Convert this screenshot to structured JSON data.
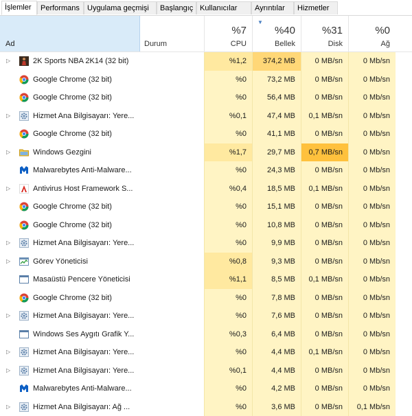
{
  "tabs": [
    {
      "label": "İşlemler",
      "active": true
    },
    {
      "label": "Performans",
      "active": false
    },
    {
      "label": "Uygulama geçmişi",
      "active": false
    },
    {
      "label": "Başlangıç",
      "active": false
    },
    {
      "label": "Kullanıcılar",
      "active": false
    },
    {
      "label": "Ayrıntılar",
      "active": false
    },
    {
      "label": "Hizmetler",
      "active": false
    }
  ],
  "header": {
    "name_label": "Ad",
    "status_label": "Durum",
    "cpu": {
      "percent": "%7",
      "label": "CPU"
    },
    "memory": {
      "percent": "%40",
      "label": "Bellek"
    },
    "disk": {
      "percent": "%31",
      "label": "Disk"
    },
    "network": {
      "percent": "%0",
      "label": "Ağ"
    }
  },
  "colors": {
    "accent": "#d9ebf9",
    "heat_light": "#fff4c4",
    "heat_medium": "#ffe9a0",
    "heat_strong": "#ffd777",
    "heat_max": "#ffc13d"
  },
  "processes": [
    {
      "name": "2K Sports NBA 2K14 (32 bit)",
      "icon": "nba-game-icon",
      "expandable": true,
      "cpu": "%1,2",
      "memory": "374,2 MB",
      "disk": "0 MB/sn",
      "network": "0 Mb/sn",
      "cpu_heat": "m",
      "mem_heat": "s",
      "disk_heat": "l",
      "net_heat": "l"
    },
    {
      "name": "Google Chrome (32 bit)",
      "icon": "chrome-icon",
      "expandable": false,
      "cpu": "%0",
      "memory": "73,2 MB",
      "disk": "0 MB/sn",
      "network": "0 Mb/sn",
      "cpu_heat": "l",
      "mem_heat": "l",
      "disk_heat": "l",
      "net_heat": "l"
    },
    {
      "name": "Google Chrome (32 bit)",
      "icon": "chrome-icon",
      "expandable": false,
      "cpu": "%0",
      "memory": "56,4 MB",
      "disk": "0 MB/sn",
      "network": "0 Mb/sn",
      "cpu_heat": "l",
      "mem_heat": "l",
      "disk_heat": "l",
      "net_heat": "l"
    },
    {
      "name": "Hizmet Ana Bilgisayarı: Yere...",
      "icon": "gear-service-icon",
      "expandable": true,
      "cpu": "%0,1",
      "memory": "47,4 MB",
      "disk": "0,1 MB/sn",
      "network": "0 Mb/sn",
      "cpu_heat": "l",
      "mem_heat": "l",
      "disk_heat": "l",
      "net_heat": "l"
    },
    {
      "name": "Google Chrome (32 bit)",
      "icon": "chrome-icon",
      "expandable": false,
      "cpu": "%0",
      "memory": "41,1 MB",
      "disk": "0 MB/sn",
      "network": "0 Mb/sn",
      "cpu_heat": "l",
      "mem_heat": "l",
      "disk_heat": "l",
      "net_heat": "l"
    },
    {
      "name": "Windows Gezgini",
      "icon": "folder-icon",
      "expandable": true,
      "cpu": "%1,7",
      "memory": "29,7 MB",
      "disk": "0,7 MB/sn",
      "network": "0 Mb/sn",
      "cpu_heat": "m",
      "mem_heat": "l",
      "disk_heat": "o",
      "net_heat": "l"
    },
    {
      "name": "Malwarebytes Anti-Malware...",
      "icon": "malwarebytes-icon",
      "expandable": false,
      "cpu": "%0",
      "memory": "24,3 MB",
      "disk": "0 MB/sn",
      "network": "0 Mb/sn",
      "cpu_heat": "l",
      "mem_heat": "l",
      "disk_heat": "l",
      "net_heat": "l"
    },
    {
      "name": "Antivirus Host Framework S...",
      "icon": "avira-icon",
      "expandable": true,
      "cpu": "%0,4",
      "memory": "18,5 MB",
      "disk": "0,1 MB/sn",
      "network": "0 Mb/sn",
      "cpu_heat": "l",
      "mem_heat": "l",
      "disk_heat": "l",
      "net_heat": "l"
    },
    {
      "name": "Google Chrome (32 bit)",
      "icon": "chrome-icon",
      "expandable": false,
      "cpu": "%0",
      "memory": "15,1 MB",
      "disk": "0 MB/sn",
      "network": "0 Mb/sn",
      "cpu_heat": "l",
      "mem_heat": "l",
      "disk_heat": "l",
      "net_heat": "l"
    },
    {
      "name": "Google Chrome (32 bit)",
      "icon": "chrome-icon",
      "expandable": false,
      "cpu": "%0",
      "memory": "10,8 MB",
      "disk": "0 MB/sn",
      "network": "0 Mb/sn",
      "cpu_heat": "l",
      "mem_heat": "l",
      "disk_heat": "l",
      "net_heat": "l"
    },
    {
      "name": "Hizmet Ana Bilgisayarı: Yere...",
      "icon": "gear-service-icon",
      "expandable": true,
      "cpu": "%0",
      "memory": "9,9 MB",
      "disk": "0 MB/sn",
      "network": "0 Mb/sn",
      "cpu_heat": "l",
      "mem_heat": "l",
      "disk_heat": "l",
      "net_heat": "l"
    },
    {
      "name": "Görev Yöneticisi",
      "icon": "task-manager-icon",
      "expandable": true,
      "cpu": "%0,8",
      "memory": "9,3 MB",
      "disk": "0 MB/sn",
      "network": "0 Mb/sn",
      "cpu_heat": "m",
      "mem_heat": "l",
      "disk_heat": "l",
      "net_heat": "l"
    },
    {
      "name": "Masaüstü Pencere Yöneticisi",
      "icon": "window-manager-icon",
      "expandable": false,
      "cpu": "%1,1",
      "memory": "8,5 MB",
      "disk": "0,1 MB/sn",
      "network": "0 Mb/sn",
      "cpu_heat": "m",
      "mem_heat": "l",
      "disk_heat": "l",
      "net_heat": "l"
    },
    {
      "name": "Google Chrome (32 bit)",
      "icon": "chrome-icon",
      "expandable": false,
      "cpu": "%0",
      "memory": "7,8 MB",
      "disk": "0 MB/sn",
      "network": "0 Mb/sn",
      "cpu_heat": "l",
      "mem_heat": "l",
      "disk_heat": "l",
      "net_heat": "l"
    },
    {
      "name": "Hizmet Ana Bilgisayarı: Yere...",
      "icon": "gear-service-icon",
      "expandable": true,
      "cpu": "%0",
      "memory": "7,6 MB",
      "disk": "0 MB/sn",
      "network": "0 Mb/sn",
      "cpu_heat": "l",
      "mem_heat": "l",
      "disk_heat": "l",
      "net_heat": "l"
    },
    {
      "name": "Windows Ses Aygıtı Grafik Y...",
      "icon": "window-manager-icon",
      "expandable": false,
      "cpu": "%0,3",
      "memory": "6,4 MB",
      "disk": "0 MB/sn",
      "network": "0 Mb/sn",
      "cpu_heat": "l",
      "mem_heat": "l",
      "disk_heat": "l",
      "net_heat": "l"
    },
    {
      "name": "Hizmet Ana Bilgisayarı: Yere...",
      "icon": "gear-service-icon",
      "expandable": true,
      "cpu": "%0",
      "memory": "4,4 MB",
      "disk": "0,1 MB/sn",
      "network": "0 Mb/sn",
      "cpu_heat": "l",
      "mem_heat": "l",
      "disk_heat": "l",
      "net_heat": "l"
    },
    {
      "name": "Hizmet Ana Bilgisayarı: Yere...",
      "icon": "gear-service-icon",
      "expandable": true,
      "cpu": "%0,1",
      "memory": "4,4 MB",
      "disk": "0 MB/sn",
      "network": "0 Mb/sn",
      "cpu_heat": "l",
      "mem_heat": "l",
      "disk_heat": "l",
      "net_heat": "l"
    },
    {
      "name": "Malwarebytes Anti-Malware...",
      "icon": "malwarebytes-icon",
      "expandable": false,
      "cpu": "%0",
      "memory": "4,2 MB",
      "disk": "0 MB/sn",
      "network": "0 Mb/sn",
      "cpu_heat": "l",
      "mem_heat": "l",
      "disk_heat": "l",
      "net_heat": "l"
    },
    {
      "name": "Hizmet Ana Bilgisayarı: Ağ ...",
      "icon": "gear-service-icon",
      "expandable": true,
      "cpu": "%0",
      "memory": "3,6 MB",
      "disk": "0 MB/sn",
      "network": "0,1 Mb/sn",
      "cpu_heat": "l",
      "mem_heat": "l",
      "disk_heat": "l",
      "net_heat": "l"
    }
  ]
}
